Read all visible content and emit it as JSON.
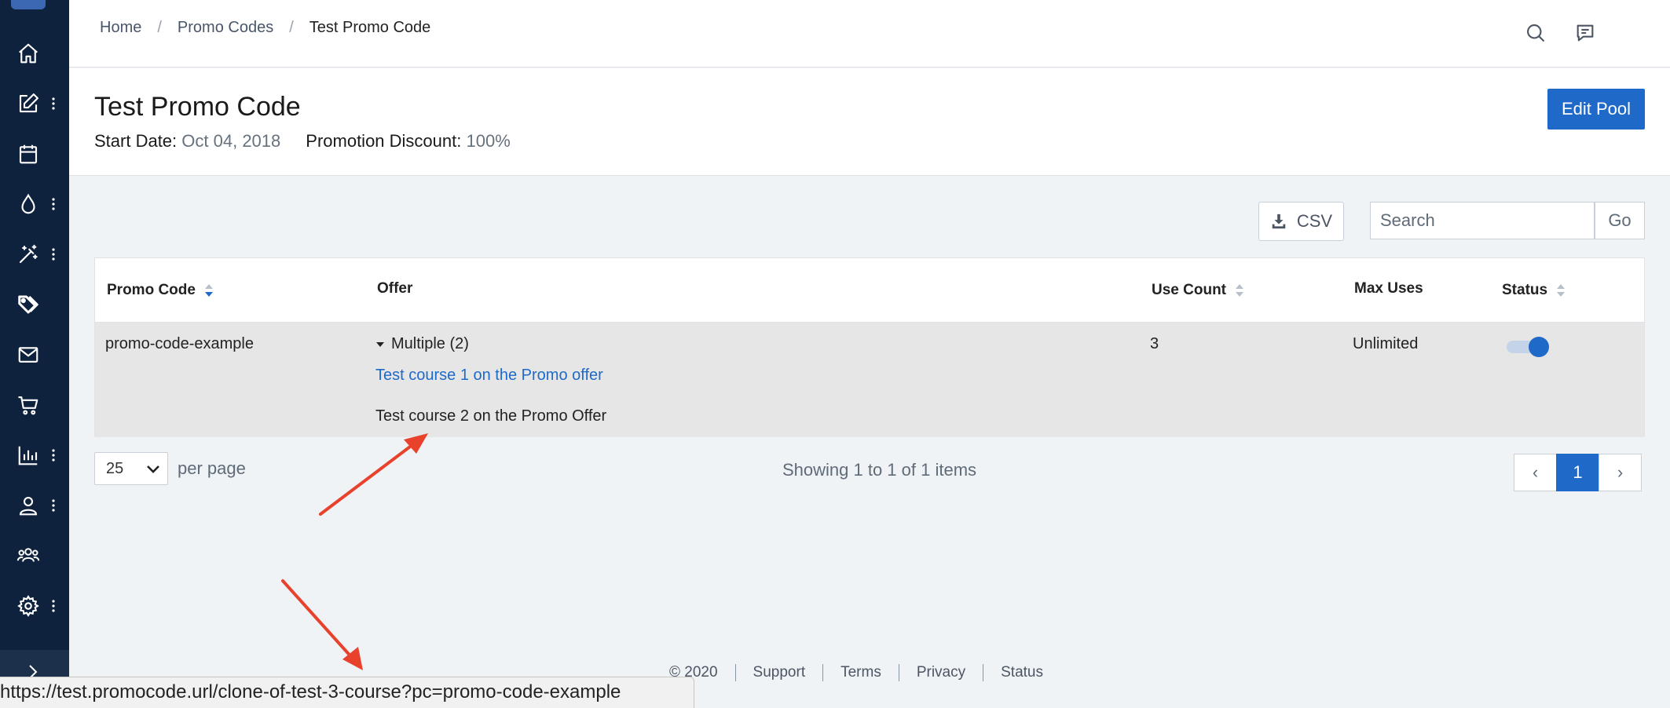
{
  "breadcrumb": {
    "items": [
      "Home",
      "Promo Codes",
      "Test Promo Code"
    ],
    "separator": "/"
  },
  "header": {
    "title": "Test Promo Code",
    "start_date_label": "Start Date:",
    "start_date_value": "Oct 04, 2018",
    "discount_label": "Promotion Discount:",
    "discount_value": "100%",
    "edit_button": "Edit Pool"
  },
  "toolbar": {
    "csv_label": "CSV",
    "search_placeholder": "Search",
    "go_label": "Go"
  },
  "table": {
    "columns": {
      "promo_code": "Promo Code",
      "offer": "Offer",
      "use_count": "Use Count",
      "max_uses": "Max Uses",
      "status": "Status"
    },
    "rows": [
      {
        "promo_code": "promo-code-example",
        "offer_summary": "Multiple (2)",
        "offers": [
          "Test course 1 on the Promo offer",
          "Test course 2 on the Promo Offer"
        ],
        "use_count": "3",
        "max_uses": "Unlimited",
        "status_enabled": true
      }
    ]
  },
  "pagination": {
    "per_page_value": "25",
    "per_page_label": "per page",
    "showing_text": "Showing 1 to 1 of 1 items",
    "prev": "‹",
    "current_page": "1",
    "next": "›"
  },
  "footer": {
    "items": [
      "© 2020",
      "Support",
      "Terms",
      "Privacy",
      "Status"
    ]
  },
  "status_bar": {
    "url": "https://test.promocode.url/clone-of-test-3-course?pc=promo-code-example"
  },
  "sidebar": {
    "icons": [
      "home-icon",
      "edit-icon",
      "calendar-icon",
      "droplet-icon",
      "magic-wand-icon",
      "tag-icon",
      "mail-icon",
      "cart-icon",
      "bar-chart-icon",
      "user-icon",
      "users-icon",
      "gear-icon"
    ]
  },
  "colors": {
    "sidebar_bg": "#0f223d",
    "accent": "#1f6ac8",
    "annotation_arrow": "#e8412c"
  }
}
